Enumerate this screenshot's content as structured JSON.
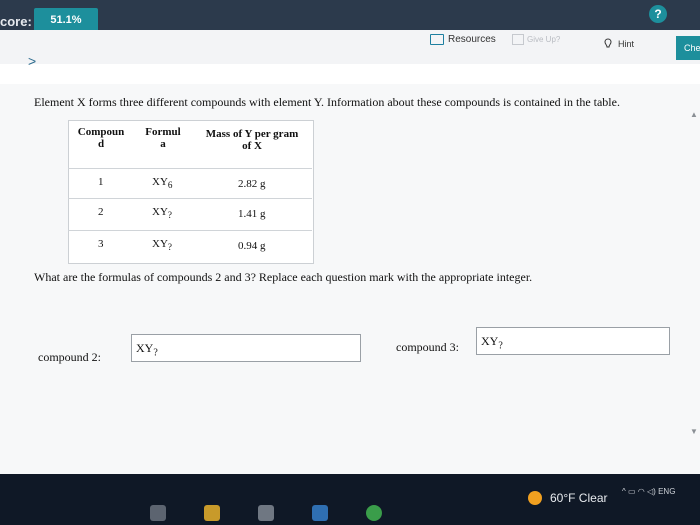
{
  "header": {
    "score_label": "core:",
    "score_value": "51.1%",
    "help_symbol": "?"
  },
  "toolbar": {
    "resources_label": "Resources",
    "giveup_label": "Give Up?",
    "hint_label": "Hint",
    "check_label": "Che"
  },
  "nav": {
    "next_symbol": ">"
  },
  "problem": {
    "intro": "Element X forms three different compounds with element Y. Information about these compounds is contained in the table.",
    "table": {
      "headers": [
        {
          "line1": "Compoun",
          "line2": "d"
        },
        {
          "line1": "Formul",
          "line2": "a"
        },
        {
          "line1": "Mass of Y per gram",
          "line2": "of X"
        }
      ],
      "rows": [
        {
          "compound": "1",
          "formula": "XY",
          "sub": "6",
          "mass": "2.82 g"
        },
        {
          "compound": "2",
          "formula": "XY",
          "sub": "?",
          "mass": "1.41 g"
        },
        {
          "compound": "3",
          "formula": "XY",
          "sub": "?",
          "mass": "0.94 g"
        }
      ]
    },
    "question": "What are the formulas of compounds 2 and 3? Replace each question mark with the appropriate integer.",
    "answers": [
      {
        "label": "compound 2:",
        "formula": "XY",
        "sub": "?"
      },
      {
        "label": "compound 3:",
        "formula": "XY",
        "sub": "?"
      }
    ]
  },
  "taskbar": {
    "weather": "60°F  Clear",
    "tray": "ENG"
  },
  "colors": {
    "accent": "#1d8f9c",
    "topbar": "#2c3a4c",
    "taskbar": "#0f1826"
  },
  "icons": [
    "resources-icon",
    "hint-bulb-icon",
    "help-icon",
    "chevron-right-icon",
    "sun-icon"
  ]
}
